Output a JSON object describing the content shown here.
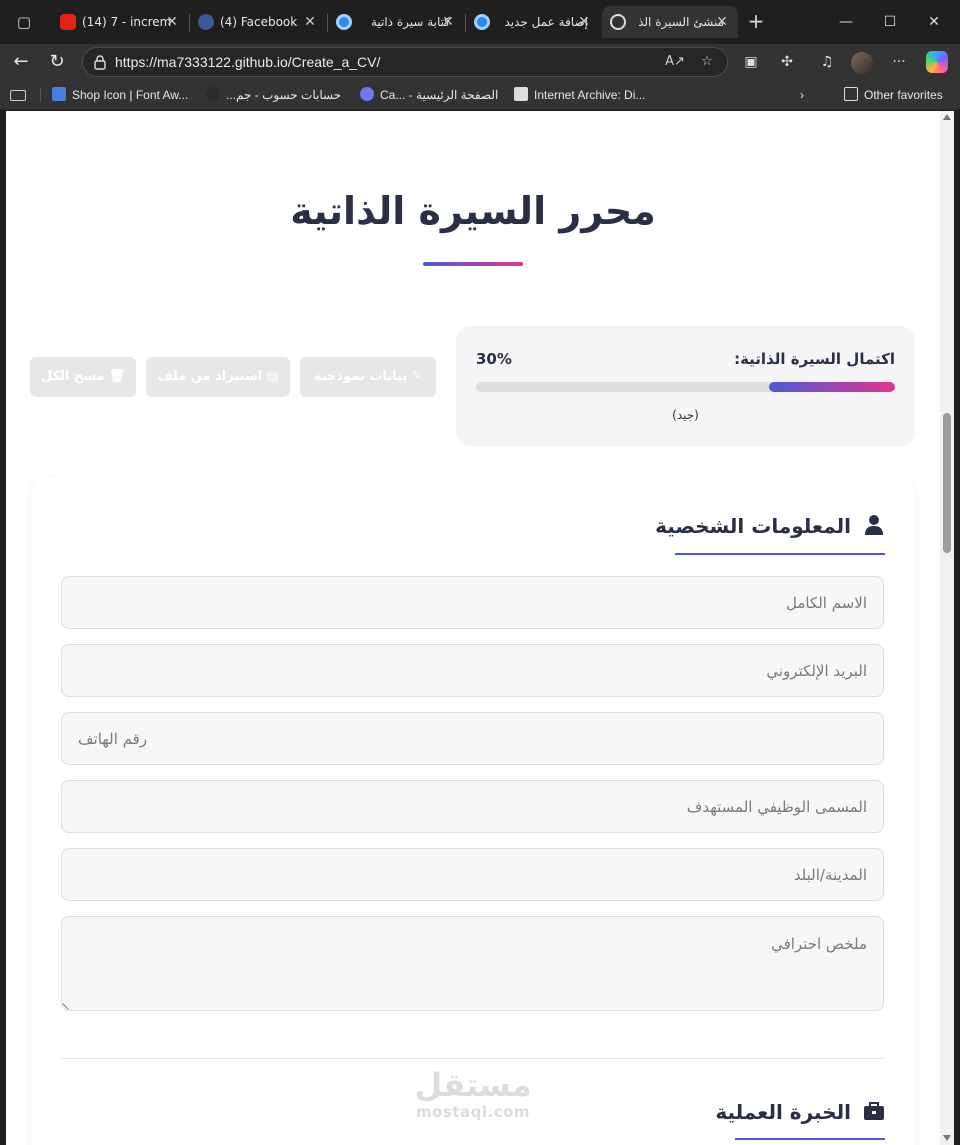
{
  "browser": {
    "tabs": [
      {
        "title": "(14) 7 - increm",
        "icon": "youtube-icon"
      },
      {
        "title": "(4) Facebook",
        "icon": "facebook-icon"
      },
      {
        "title": "كتابة سيرة ذاتية",
        "icon": "mostaql-icon"
      },
      {
        "title": "إضافة عمل جديد",
        "icon": "mostaql-icon"
      },
      {
        "title": "منشئ السيرة الذ",
        "icon": "globe-icon"
      }
    ],
    "url": "https://ma7333122.github.io/Create_a_CV/",
    "favorites": [
      {
        "label": "Shop Icon | Font Aw..."
      },
      {
        "label": "حسابات حسوب - جم..."
      },
      {
        "label": "Ca... - الصفحة الرئيسية"
      },
      {
        "label": "Internet Archive: Di..."
      }
    ],
    "other_favorites": "Other favorites"
  },
  "page": {
    "title": "محرر السيرة الذاتية",
    "progress": {
      "label": "اكتمال السيرة الذاتية:",
      "percent_text": "30%",
      "value": 0.3,
      "status": "(جيد)"
    },
    "actions": {
      "sample": "بيانات نموذجية",
      "import": "استيراد من ملف",
      "clear": "مسح الكل"
    },
    "personal": {
      "heading": "المعلومات الشخصية",
      "full_name_placeholder": "الاسم الكامل",
      "email_placeholder": "البريد الإلكتروني",
      "phone_placeholder": "رقم الهاتف",
      "job_title_placeholder": "المسمى الوظيفي المستهدف",
      "city_placeholder": "المدينة/البلد",
      "summary_placeholder": "ملخص احترافي"
    },
    "experience": {
      "heading": "الخبرة العملية"
    },
    "watermark": {
      "arabic": "مستقل",
      "latin": "mostaql.com"
    }
  },
  "colors": {
    "accent_start": "#4d5bd6",
    "accent_end": "#e0368c",
    "heading_text": "#2b2f45"
  }
}
